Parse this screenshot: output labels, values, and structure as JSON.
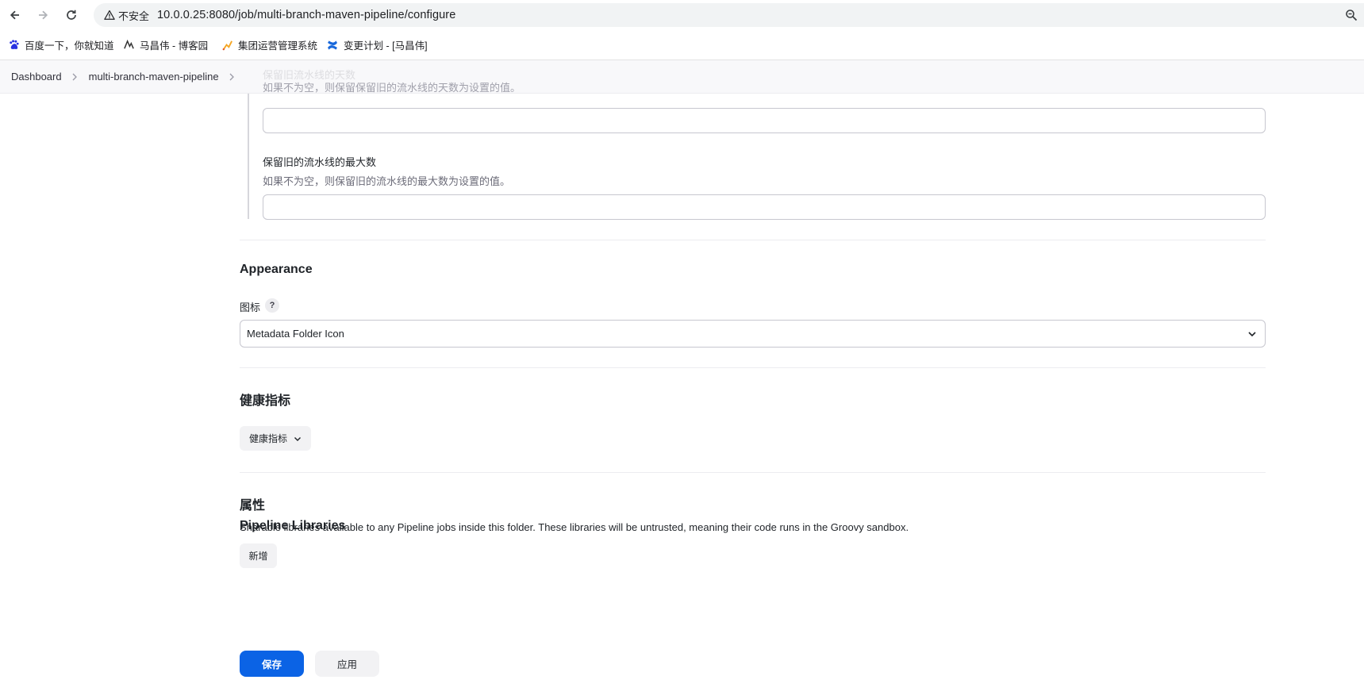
{
  "browser": {
    "security_label": "不安全",
    "url": "10.0.0.25:8080/job/multi-branch-maven-pipeline/configure",
    "bookmarks": [
      {
        "label": "百度一下，你就知道",
        "icon": "baidu-paw-icon"
      },
      {
        "label": "马昌伟 - 博客园",
        "icon": "cnblogs-icon"
      },
      {
        "label": "集团运营管理系统",
        "icon": "jenkins-like-icon"
      },
      {
        "label": "变更计划 - [马昌伟]",
        "icon": "confluence-icon"
      }
    ],
    "accent_colors": {
      "confluence": "#1868db",
      "baidu": "#2932e1",
      "ops": "#f5a623"
    }
  },
  "breadcrumb": {
    "items": [
      "Dashboard",
      "multi-branch-maven-pipeline"
    ],
    "obscured_label": "保留旧流水线的天数"
  },
  "orphan_settings": {
    "days_hint": "如果不为空，则保留保留旧的流水线的天数为设置的值。",
    "days_value": "",
    "max_label": "保留旧的流水线的最大数",
    "max_hint": "如果不为空，则保留旧的流水线的最大数为设置的值。",
    "max_value": ""
  },
  "appearance": {
    "title": "Appearance",
    "icon_label": "图标",
    "help": "?",
    "icon_selected": "Metadata Folder Icon"
  },
  "health": {
    "title": "健康指标",
    "button_label": "健康指标"
  },
  "properties": {
    "title": "属性",
    "libraries_title": "Pipeline Libraries",
    "libraries_desc": "Sharable libraries available to any Pipeline jobs inside this folder. These libraries will be untrusted, meaning their code runs in the Groovy sandbox.",
    "add_label": "新增"
  },
  "actions": {
    "save_label": "保存",
    "apply_label": "应用"
  },
  "theme": {
    "primary": "#0b63e5"
  }
}
